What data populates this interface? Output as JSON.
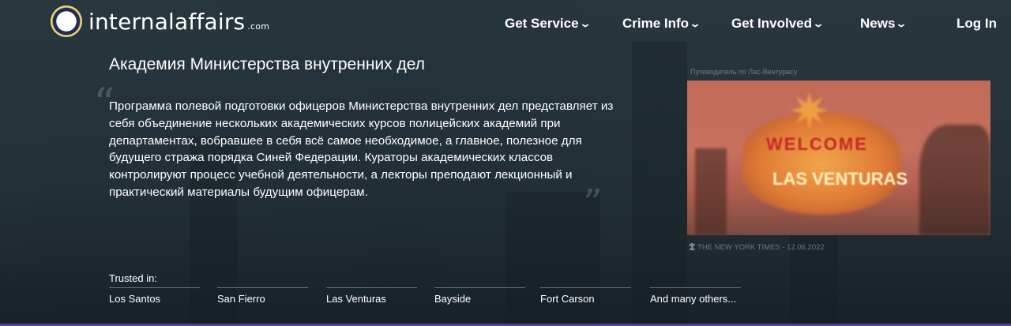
{
  "header": {
    "brand": "internalaffairs",
    "brand_suffix": ".com",
    "nav": [
      {
        "label": "Get Service",
        "dropdown": true
      },
      {
        "label": "Crime Info",
        "dropdown": true
      },
      {
        "label": "Get Involved",
        "dropdown": true
      },
      {
        "label": "News",
        "dropdown": true
      },
      {
        "label": "Log In",
        "dropdown": false
      }
    ]
  },
  "main": {
    "title": "Академия Министерства внутренних дел",
    "quote_open": "“",
    "quote_close": "”",
    "body": "Программа полевой подготовки офицеров Министерства внутренних дел представляет из себя объединение нескольких академических курсов полицейских академий при департаментах, вобравшее в себя всё самое необходимое, а главное, полезное для будущего стража порядка Синей Федерации. Кураторы академических классов контролируют процесс учебной деятельности, а лекторы преподают лекционный и практический материалы будущим офицерам."
  },
  "aside": {
    "caption": "Путеводитель по Лас-Вентурасу",
    "photo_text_1": "WELCOME",
    "photo_text_2": "LAS VENTURAS",
    "credit": "THE NEW YORK TIMES - 12.06.2022"
  },
  "trusted": {
    "label": "Trusted in:",
    "cities": [
      "Los Santos",
      "San Fierro",
      "Las Venturas",
      "Bayside",
      "Fort Carson",
      "And many others..."
    ]
  },
  "colors": {
    "background": "#26343c",
    "accent_bar": "#5a3f8f"
  }
}
